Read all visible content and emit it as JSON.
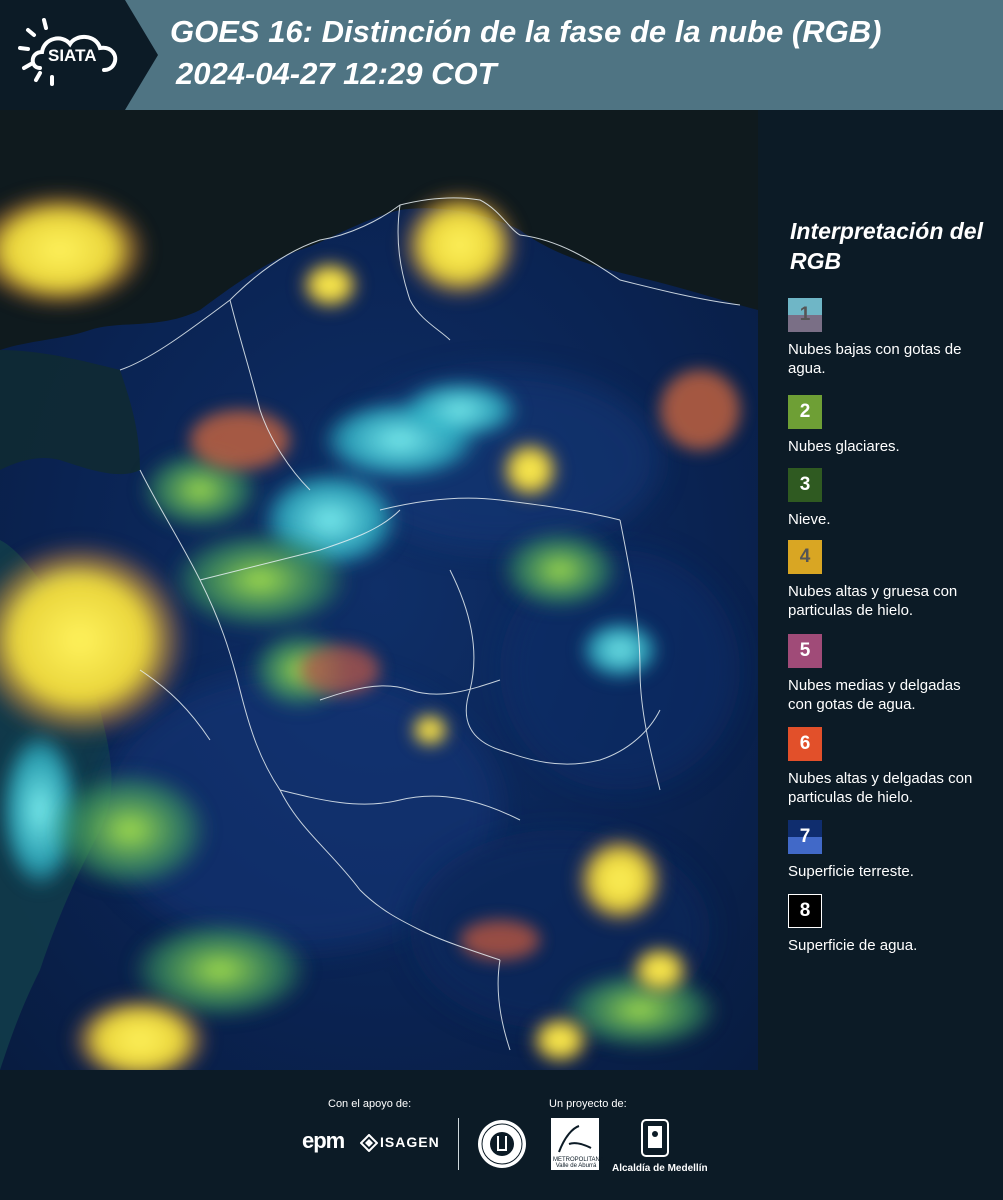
{
  "header": {
    "logo_text": "SIATA",
    "title_line1": "GOES 16: Distinción de la fase de la nube (RGB)",
    "title_line2": "2024-04-27 12:29 COT"
  },
  "legend": {
    "title": "Interpretación del RGB",
    "items": [
      {
        "number": "1",
        "label": "Nubes bajas con gotas de agua.",
        "color_top": "#6fb6c6",
        "color_bottom": "#7a6f86",
        "num_color": "#555555"
      },
      {
        "number": "2",
        "label": "Nubes glaciares.",
        "color_top": "#6e9f35",
        "color_bottom": "#6e9f35",
        "num_color": "#ffffff"
      },
      {
        "number": "3",
        "label": "Nieve.",
        "color_top": "#2f5a21",
        "color_bottom": "#2f5a21",
        "num_color": "#ffffff"
      },
      {
        "number": "4",
        "label": "Nubes altas y gruesa con particulas de hielo.",
        "color_top": "#d9a623",
        "color_bottom": "#d9a623",
        "num_color": "#555555"
      },
      {
        "number": "5",
        "label": "Nubes medias y delgadas con gotas de agua.",
        "color_top": "#a04b78",
        "color_bottom": "#a04b78",
        "num_color": "#ffffff"
      },
      {
        "number": "6",
        "label": "Nubes altas y delgadas con particulas de hielo.",
        "color_top": "#e2502a",
        "color_bottom": "#e2502a",
        "num_color": "#ffffff"
      },
      {
        "number": "7",
        "label": "Superficie terreste.",
        "color_top": "#0f2d6e",
        "color_bottom": "#4169c8",
        "num_color": "#ffffff"
      },
      {
        "number": "8",
        "label": "Superficie de agua.",
        "color_top": "#000000",
        "color_bottom": "#000000",
        "num_color": "#ffffff"
      }
    ]
  },
  "footer": {
    "support_label": "Con el apoyo de:",
    "project_label": "Un proyecto de:",
    "epm": "epm",
    "isagen": "ISAGEN",
    "area_text": "METROPOLITANA Valle de Aburrá",
    "alcaldia": "Alcaldía de Medellín"
  },
  "colors": {
    "header_bg": "#4f7483",
    "logo_bg": "#0c1b26",
    "page_bg": "#0c1b26",
    "land": "#0a2352",
    "cloud_yellow": "#f6e84a",
    "cloud_cyan": "#53d6e0",
    "cloud_orange": "#e06a3a"
  }
}
